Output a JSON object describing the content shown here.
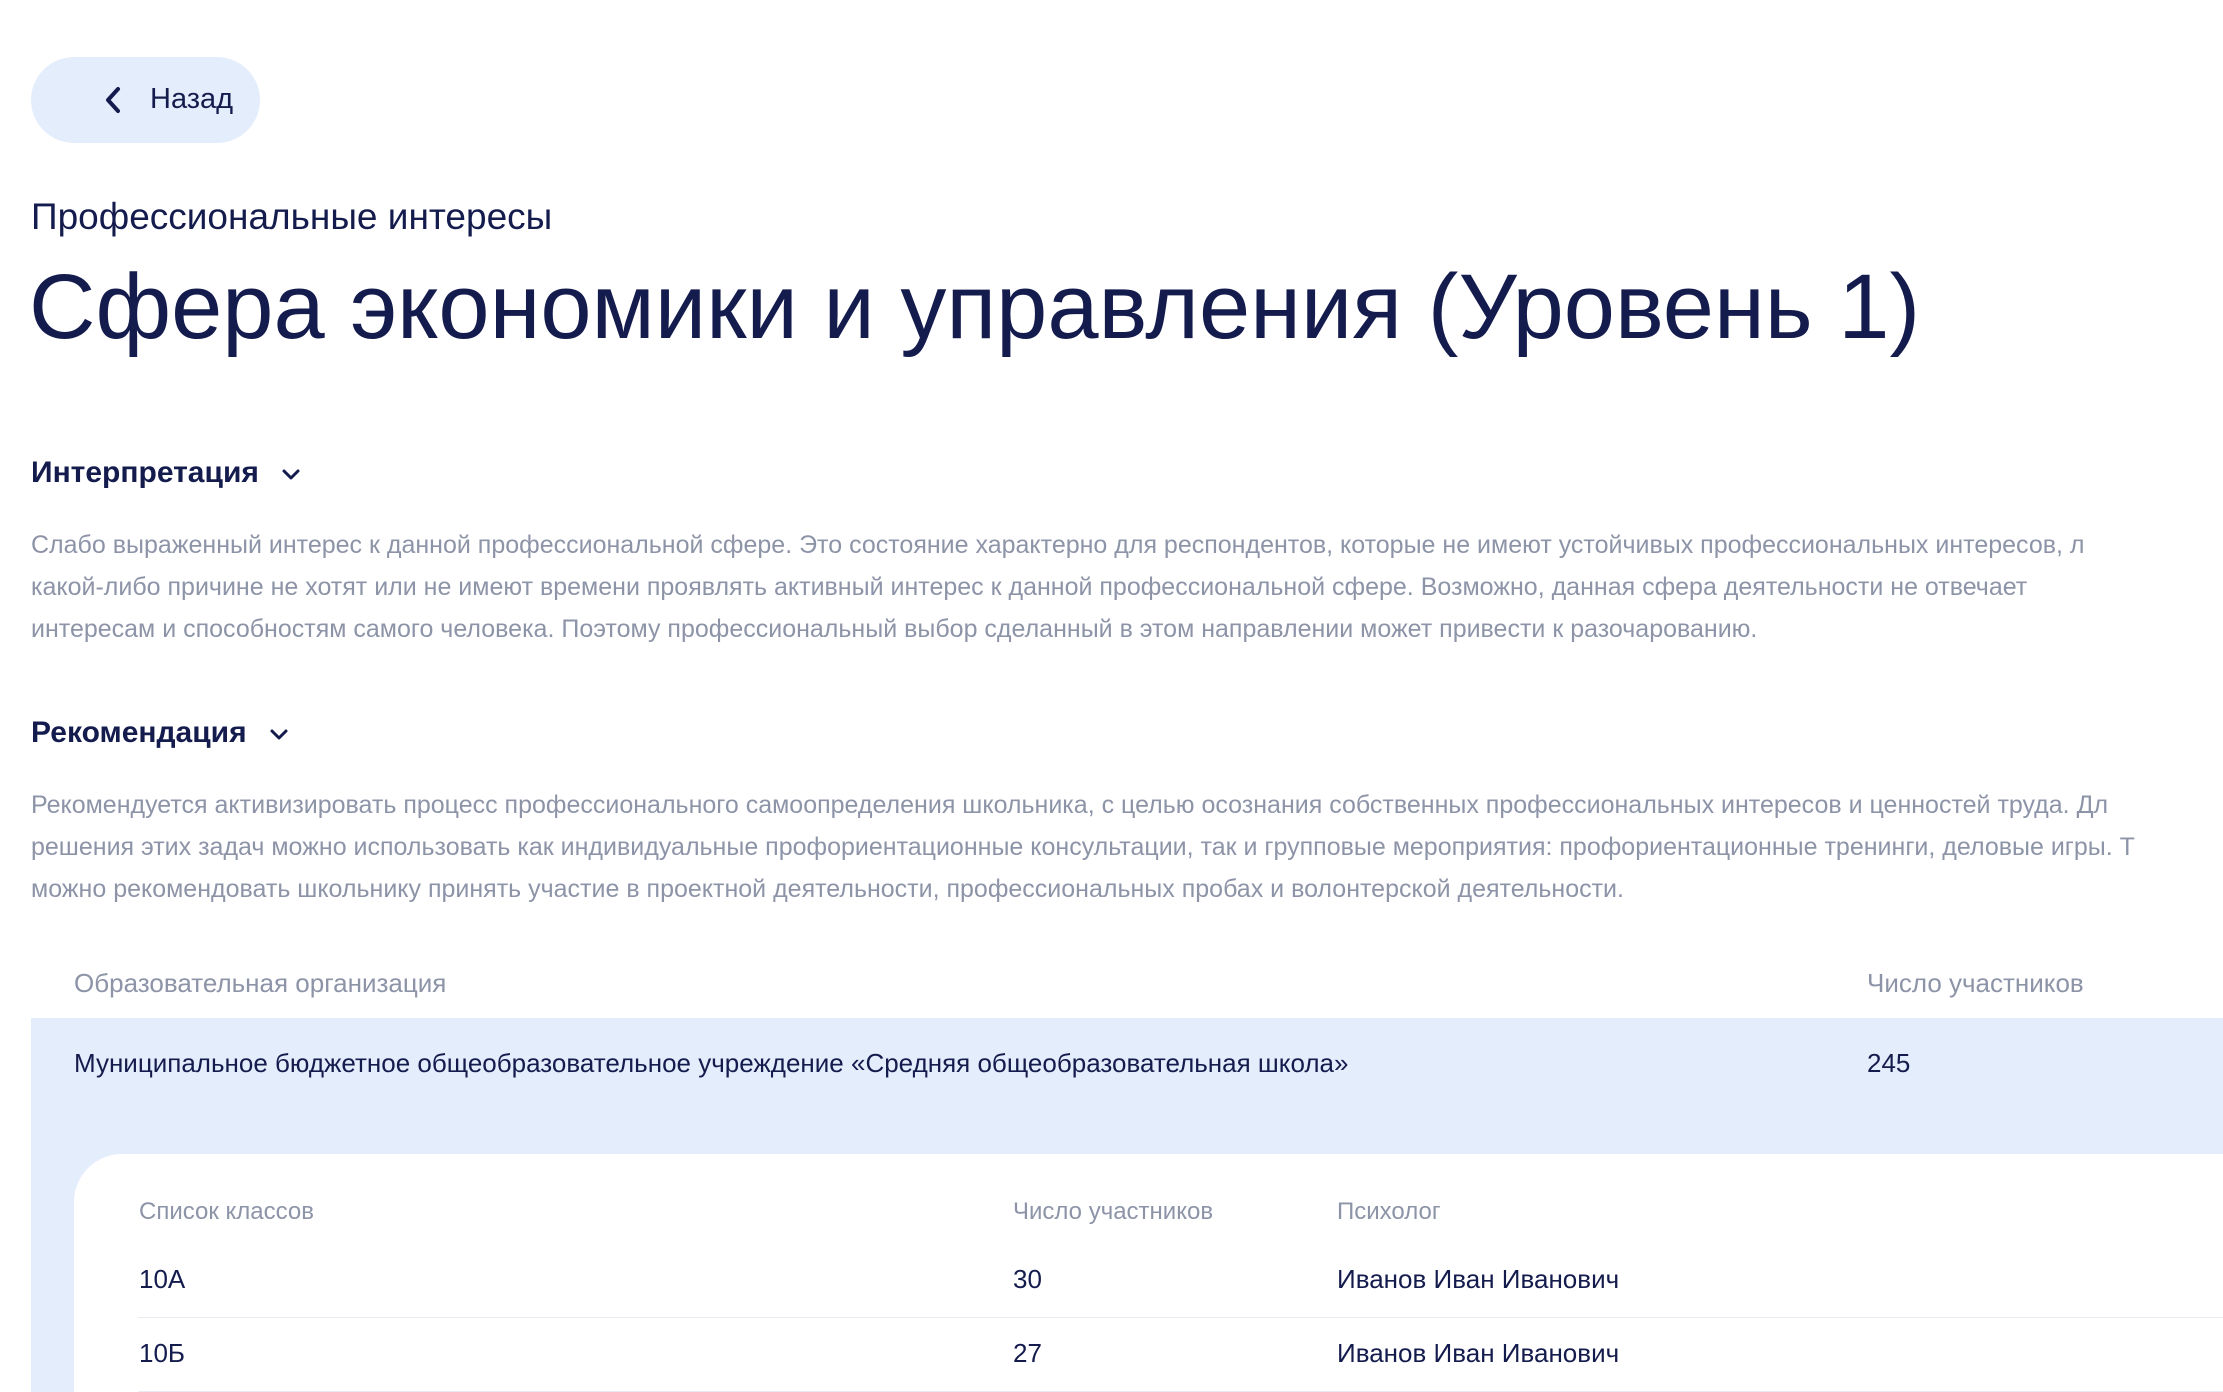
{
  "nav": {
    "back_label": "Назад"
  },
  "header": {
    "subtitle": "Профессиональные интересы",
    "title": "Сфера экономики и управления (Уровень 1)"
  },
  "interpretation": {
    "heading": "Интерпретация",
    "lines": [
      "Слабо выраженный интерес к данной профессиональной сфере. Это состояние  характерно  для респондентов,  которые  не имеют устойчивых  профессиональных интересов,  л",
      "какой-либо причине не  хотят  или  не  имеют  времени  проявлять активный  интерес  к  данной профессиональной сфере.  Возможно, данная сфера деятельности не отвечает",
      "интересам  и  способностям  самого  человека.  Поэтому профессиональный  выбор сделанный в этом направлении  может привести к  разочарованию."
    ]
  },
  "recommendation": {
    "heading": "Рекомендация",
    "lines": [
      "Рекомендуется активизировать  процесс профессионального самоопределения школьника, с целью осознания собственных профессиональных интересов и ценностей труда. Дл",
      "решения этих задач можно использовать как индивидуальные профориентационные консультации, так и групповые мероприятия: профориентационные тренинги, деловые игры. Т",
      "можно рекомендовать школьнику принять участие в проектной деятельности, профессиональных пробах и волонтерской деятельности."
    ]
  },
  "org_table": {
    "col_org": "Образовательная организация",
    "col_count": "Число участников",
    "row": {
      "name": "Муниципальное бюджетное общеобразовательное учреждение «Средняя общеобразовательная школа»",
      "count": "245"
    }
  },
  "classes_table": {
    "col_class": "Список классов",
    "col_count": "Число участников",
    "col_psychologist": "Психолог",
    "rows": [
      {
        "class": "10А",
        "count": "30",
        "psychologist": "Иванов Иван Иванович"
      },
      {
        "class": "10Б",
        "count": "27",
        "psychologist": "Иванов Иван Иванович"
      }
    ]
  },
  "colors": {
    "accent_bg": "#e4edfc",
    "text_dark": "#141b4d",
    "text_muted": "#8d94a8"
  }
}
